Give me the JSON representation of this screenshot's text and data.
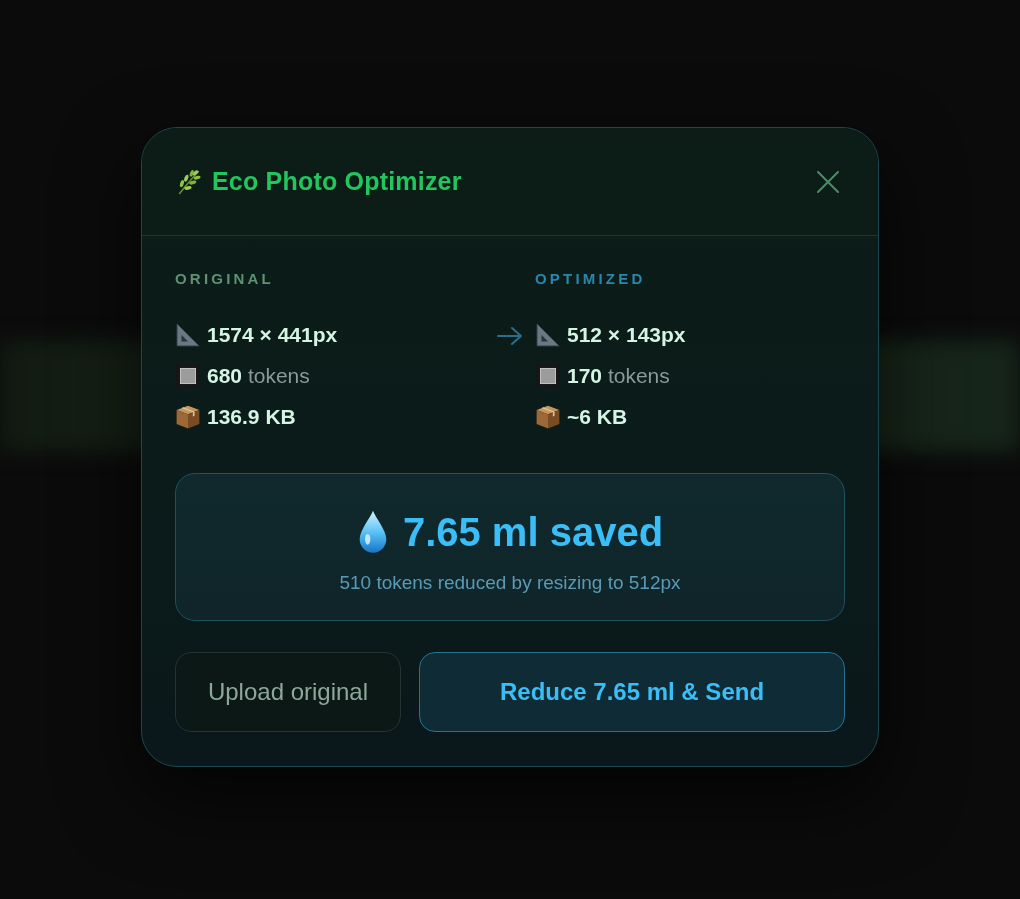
{
  "dialog": {
    "title": "Eco Photo Optimizer"
  },
  "comparison": [
    {
      "kind": "original",
      "heading": "ORIGINAL",
      "rows": [
        {
          "kind": "dimensions",
          "value": "1574 × 441px"
        },
        {
          "kind": "tokens",
          "value": "680",
          "unit": "tokens"
        },
        {
          "kind": "size",
          "value": "136.9 KB"
        }
      ]
    },
    {
      "kind": "optimized",
      "heading": "OPTIMIZED",
      "rows": [
        {
          "kind": "dimensions",
          "value": "512 × 143px"
        },
        {
          "kind": "tokens",
          "value": "170",
          "unit": "tokens"
        },
        {
          "kind": "size",
          "value": "~6 KB"
        }
      ]
    }
  ],
  "savings": {
    "headline": "7.65 ml saved",
    "detail": "510 tokens reduced by resizing to 512px"
  },
  "buttons": [
    {
      "kind": "secondary",
      "label": "Upload original"
    },
    {
      "kind": "primary",
      "label": "Reduce 7.65 ml & Send"
    }
  ]
}
